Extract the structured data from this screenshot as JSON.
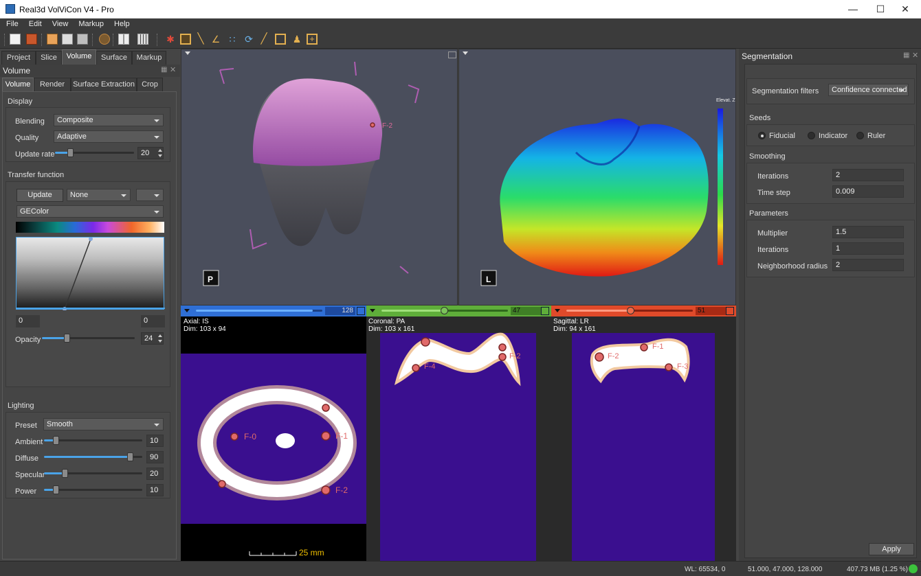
{
  "app": {
    "title": "Real3d VolViCon V4 - Pro"
  },
  "menu": [
    "File",
    "Edit",
    "View",
    "Markup",
    "Help"
  ],
  "left_panel": {
    "main_tabs": [
      "Project",
      "Slice",
      "Volume",
      "Surface",
      "Markup"
    ],
    "panel_title": "Volume",
    "sub_tabs": [
      "Volume",
      "Render",
      "Surface Extraction",
      "Crop"
    ],
    "display": {
      "title": "Display",
      "blending_label": "Blending",
      "blending_value": "Composite",
      "quality_label": "Quality",
      "quality_value": "Adaptive",
      "update_rate_label": "Update rate",
      "update_rate_value": "20"
    },
    "transfer": {
      "title": "Transfer function",
      "update_button": "Update",
      "preset_value": "None",
      "colormap_value": "GEColor",
      "min_value": "0",
      "max_value": "0",
      "opacity_label": "Opacity",
      "opacity_value": "24"
    },
    "lighting": {
      "title": "Lighting",
      "preset_label": "Preset",
      "preset_value": "Smooth",
      "ambient_label": "Ambient",
      "ambient_value": "10",
      "diffuse_label": "Diffuse",
      "diffuse_value": "90",
      "specular_label": "Specular",
      "specular_value": "20",
      "power_label": "Power",
      "power_value": "10"
    }
  },
  "views": {
    "volume_3d": {
      "fiducial_label": "F-2"
    },
    "surface_3d": {
      "colorbar_title": "Elevat. Z"
    },
    "axial": {
      "title": "Axial: IS",
      "dim": "Dim: 103 x 94",
      "slider_value": "128",
      "scale_label": "25 mm",
      "fiducials": [
        "F-0",
        "F-1",
        "F-2"
      ]
    },
    "coronal": {
      "title": "Coronal: PA",
      "dim": "Dim: 103 x 161",
      "slider_value": "47",
      "fiducials": [
        "F-4",
        "F-2"
      ]
    },
    "sagittal": {
      "title": "Sagittal: LR",
      "dim": "Dim: 94 x 161",
      "slider_value": "51",
      "fiducials": [
        "F-2",
        "F-1",
        "F-3"
      ]
    }
  },
  "right_panel": {
    "title": "Segmentation",
    "filters_label": "Segmentation filters",
    "filters_value": "Confidence connected",
    "seeds": {
      "title": "Seeds",
      "options": [
        "Fiducial",
        "Indicator",
        "Ruler"
      ],
      "selected": "Fiducial"
    },
    "smoothing": {
      "title": "Smoothing",
      "iterations_label": "Iterations",
      "iterations_value": "2",
      "timestep_label": "Time step",
      "timestep_value": "0.009"
    },
    "parameters": {
      "title": "Parameters",
      "multiplier_label": "Multiplier",
      "multiplier_value": "1.5",
      "iterations_label": "Iterations",
      "iterations_value": "1",
      "radius_label": "Neighborhood radius",
      "radius_value": "2"
    },
    "apply_button": "Apply"
  },
  "status": {
    "wl": "WL: 65534, 0",
    "coords": "51.000, 47.000, 128.000",
    "memory": "407.73 MB (1.25 %)"
  },
  "colors": {
    "accent": "#4aa3e8",
    "axial_bar": "#2f6fd6",
    "coronal_bar": "#5fae3a",
    "sagittal_bar": "#e04a2a",
    "slice_bg": "#3a0f8f",
    "status_ok": "#3cc23c"
  }
}
